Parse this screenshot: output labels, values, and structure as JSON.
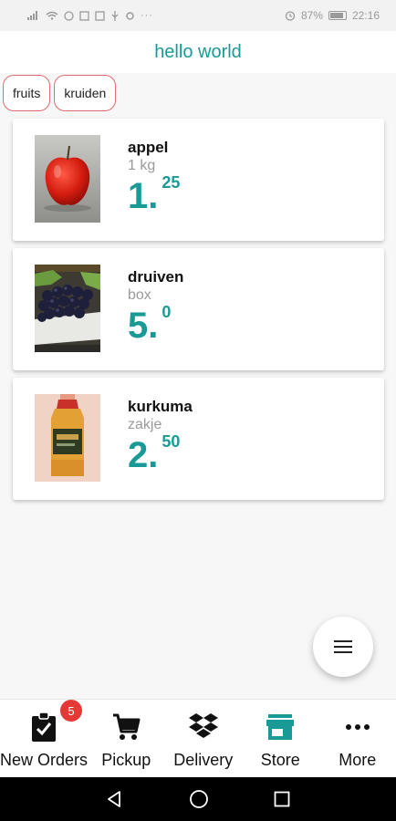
{
  "status_bar": {
    "left": "∙∙∙",
    "battery": "87%",
    "time": "22:16"
  },
  "header": {
    "title": "hello world"
  },
  "chips": [
    {
      "label": "fruits"
    },
    {
      "label": "kruiden"
    }
  ],
  "products": [
    {
      "name": "appel",
      "unit": "1 kg",
      "price_main": "1.",
      "price_cents": "25"
    },
    {
      "name": "druiven",
      "unit": "box",
      "price_main": "5.",
      "price_cents": "0"
    },
    {
      "name": "kurkuma",
      "unit": "zakje",
      "price_main": "2.",
      "price_cents": "50"
    }
  ],
  "fab": {
    "icon": "menu-icon"
  },
  "bottom_nav": {
    "items": [
      {
        "label": "New Orders",
        "icon": "clipboard-check-icon",
        "badge": "5"
      },
      {
        "label": "Pickup",
        "icon": "cart-icon"
      },
      {
        "label": "Delivery",
        "icon": "dropbox-icon"
      },
      {
        "label": "Store",
        "icon": "store-icon",
        "active": true
      },
      {
        "label": "More",
        "icon": "more-horiz-icon"
      }
    ]
  },
  "colors": {
    "accent": "#1a9a96",
    "chip_border": "#e06d6d",
    "badge": "#e53935"
  }
}
